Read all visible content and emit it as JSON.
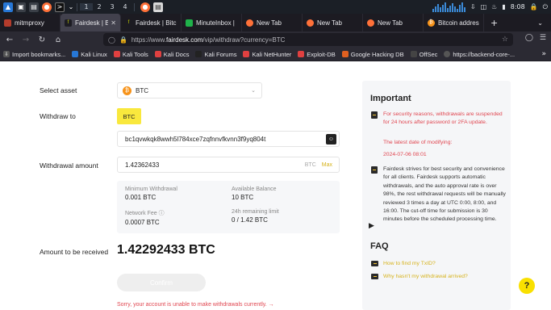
{
  "os_panel": {
    "workspaces": [
      "1",
      "2",
      "3",
      "4"
    ],
    "active_workspace": "1",
    "clock": "8:08",
    "accent": "#3b8ad8"
  },
  "tabs": [
    {
      "title": "mitmproxy",
      "icon": "mitmproxy-icon",
      "color": "#b43c2c",
      "active": false
    },
    {
      "title": "Fairdesk | Bitc",
      "icon": "fairdesk-icon",
      "color": "#c9d400",
      "active": true
    },
    {
      "title": "Fairdesk | Bitc",
      "icon": "fairdesk-icon",
      "color": "#c9d400",
      "active": false
    },
    {
      "title": "MinuteInbox |",
      "icon": "minuteinbox-icon",
      "color": "#1fb24a",
      "active": false
    },
    {
      "title": "New Tab",
      "icon": "firefox-icon",
      "color": "#ff7139",
      "active": false
    },
    {
      "title": "New Tab",
      "icon": "firefox-icon",
      "color": "#ff7139",
      "active": false
    },
    {
      "title": "New Tab",
      "icon": "firefox-icon",
      "color": "#ff7139",
      "active": false
    },
    {
      "title": "Bitcoin addres",
      "icon": "bitcoin-icon",
      "color": "#f7931a",
      "active": false
    }
  ],
  "newtab_label": "+",
  "url": {
    "prefix": "https://www.",
    "domain": "fairdesk.com",
    "path": "/vip/withdraw?currency=BTC"
  },
  "bookmarks": [
    {
      "label": "Import bookmarks...",
      "icon": "import-icon",
      "color": "#555"
    },
    {
      "label": "Kali Linux",
      "icon": "kali-icon",
      "color": "#2777d6"
    },
    {
      "label": "Kali Tools",
      "icon": "kali-icon",
      "color": "#e04040"
    },
    {
      "label": "Kali Docs",
      "icon": "kali-icon",
      "color": "#e04040"
    },
    {
      "label": "Kali Forums",
      "icon": "kali-icon",
      "color": "#222"
    },
    {
      "label": "Kali NetHunter",
      "icon": "kali-icon",
      "color": "#e04040"
    },
    {
      "label": "Exploit-DB",
      "icon": "exploitdb-icon",
      "color": "#e04040"
    },
    {
      "label": "Google Hacking DB",
      "icon": "ghdb-icon",
      "color": "#e06020"
    },
    {
      "label": "OffSec",
      "icon": "offsec-icon",
      "color": "#444"
    },
    {
      "label": "https://backend-core-...",
      "icon": "globe-icon",
      "color": "#555"
    }
  ],
  "form": {
    "select_asset_label": "Select asset",
    "asset": "BTC",
    "withdraw_to_label": "Withdraw to",
    "network_chip": "BTC",
    "address": "bc1qvwkqk8wwh5l784xce7zqfnnvfkvnn3f9yq804t",
    "withdrawal_amount_label": "Withdrawal amount",
    "amount": "1.42362433",
    "amount_currency": "BTC",
    "max_label": "Max",
    "min_withdrawal_label": "Minimum Withdrawal",
    "min_withdrawal": "0.001 BTC",
    "available_balance_label": "Available Balance",
    "available_balance": "10 BTC",
    "network_fee_label": "Network Fee ⓘ",
    "network_fee": "0.0007 BTC",
    "limit_label": "24h remaining limit",
    "limit": "0 / 1.42 BTC",
    "received_label": "Amount to be received",
    "received": "1.42292433 BTC",
    "confirm_label": "Confirm",
    "error": "Sorry, your account is unable to make withdrawals currently. →"
  },
  "important": {
    "title": "Important",
    "notice1": "For security reasons, withdrawals are suspended for 24 hours after password or 2FA update.",
    "date_label": "The latest date of modifying:",
    "date": "2024-07-06 08:01",
    "notice2": "Fairdesk strives for best security and convenience for all clients. Fairdesk supports automatic withdrawals, and the auto approval rate is over 98%, the rest withdrawal requests will be manually reviewed 3 times a day at UTC 0:00, 8:00, and 16:00. The cut-off time for submission is 30 minutes before the scheduled processing time.",
    "faq_title": "FAQ",
    "faq": [
      "How to find my TxID?",
      "Why hasn't my withdrawal arrived?"
    ]
  },
  "help_label": "?",
  "colors": {
    "brand": "#f9e83d",
    "error": "#e0454f",
    "link": "#d6b21b"
  }
}
